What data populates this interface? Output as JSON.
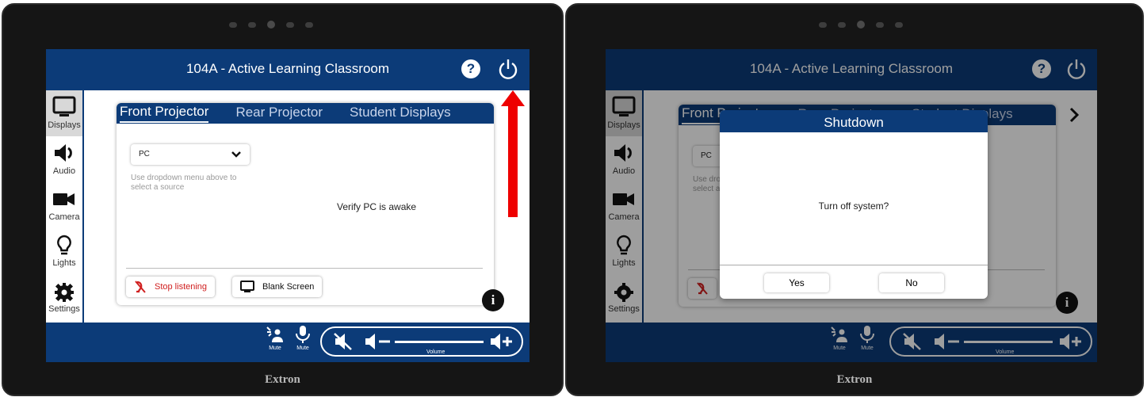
{
  "room_title": "104A - Active Learning Classroom",
  "help_label": "?",
  "sidebar": {
    "items": [
      {
        "label": "Displays"
      },
      {
        "label": "Audio"
      },
      {
        "label": "Camera"
      },
      {
        "label": "Lights"
      },
      {
        "label": "Settings"
      }
    ]
  },
  "tabs": [
    "Front Projector",
    "Rear Projector",
    "Student Displays"
  ],
  "source_select": {
    "value": "PC"
  },
  "hint": "Use dropdown menu above to select a source",
  "status_message": "Verify PC is awake",
  "buttons": {
    "stop_listening": "Stop listening",
    "blank_screen": "Blank Screen"
  },
  "info_label": "i",
  "footer": {
    "mute1": "Mute",
    "mute2": "Mute",
    "volume_label": "Volume"
  },
  "dialog": {
    "title": "Shutdown",
    "message": "Turn off system?",
    "yes": "Yes",
    "no": "No"
  },
  "brand": "Extron",
  "colors": {
    "header": "#0c3b78",
    "stop_red": "#d02020",
    "highlight_arrow": "#ee0000"
  }
}
